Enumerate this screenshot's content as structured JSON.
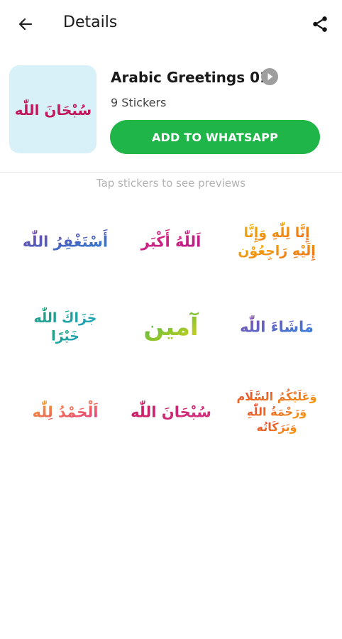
{
  "header": {
    "title": "Details",
    "back_icon": "arrow-left-icon",
    "share_icon": "share-icon"
  },
  "pack": {
    "name": "Arabic Greetings 01",
    "count": "9 Stickers",
    "add_label": "ADD TO WHATSAPP",
    "tray_text": "سُبْحَانَ اللّٰه",
    "tray_color": "#d8f0f7",
    "button_color": "#1fb549"
  },
  "hint": "Tap stickers to see previews",
  "stickers": [
    {
      "lines": [
        "أَسْتَغْفِرُ اللّٰه"
      ],
      "color_a": "#7b3fa8",
      "color_b": "#2a7fd1"
    },
    {
      "lines": [
        "اَللّٰهُ أَكْبَر"
      ],
      "color_a": "#e0297a",
      "color_b": "#b51c8a"
    },
    {
      "lines": [
        "إِنَّا لِلّٰهِ وَإِنَّا",
        "إِلَيْهِ رَاجِعُوْن"
      ],
      "color_a": "#f2b705",
      "color_b": "#ef6a1f"
    },
    {
      "lines": [
        "جَزَاكَ اللّٰه",
        "خَيْرًا"
      ],
      "color_a": "#1f9e6d",
      "color_b": "#1ea5c4"
    },
    {
      "lines": [
        "آمين"
      ],
      "color_a": "#33b44a",
      "color_b": "#d8d21a"
    },
    {
      "lines": [
        "مَاشَاءَ اللّٰه"
      ],
      "color_a": "#8e44ad",
      "color_b": "#2e86de"
    },
    {
      "lines": [
        "اَلْحَمْدُ لِلّٰه"
      ],
      "color_a": "#f5a623",
      "color_b": "#e8398a"
    },
    {
      "lines": [
        "سُبْحَانَ اللّٰه"
      ],
      "color_a": "#c2185b",
      "color_b": "#d63384"
    },
    {
      "lines": [
        "وَعَلَيْكُمُ السَّلَام",
        "وَرَحْمَةُ اللّٰهِ",
        "وَبَرَكَاتُه"
      ],
      "color_a": "#e53935",
      "color_b": "#f39c12"
    }
  ]
}
